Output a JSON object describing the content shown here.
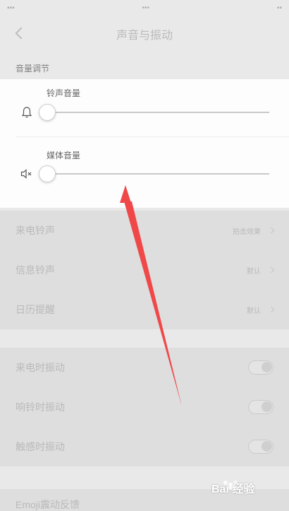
{
  "header": {
    "title": "声音与振动"
  },
  "volume_section": {
    "title": "音量调节",
    "ringtone": {
      "label": "铃声音量",
      "icon": "bell-icon",
      "level": 0
    },
    "media": {
      "label": "媒体音量",
      "icon": "speaker-muted-icon",
      "level": 0
    }
  },
  "ringtone_settings": {
    "items": [
      {
        "label": "来电铃声",
        "value": "拍击效果"
      },
      {
        "label": "信息铃声",
        "value": "默认"
      },
      {
        "label": "日历提醒",
        "value": "默认"
      }
    ]
  },
  "vibration_settings": {
    "items": [
      {
        "label": "来电时振动",
        "on": true
      },
      {
        "label": "响铃时振动",
        "on": true
      },
      {
        "label": "触感时振动",
        "on": true
      }
    ]
  },
  "partial_row": {
    "label": "Emoji震动反馈"
  },
  "watermark": "Bai 经验",
  "annotation_color": "#f04848"
}
